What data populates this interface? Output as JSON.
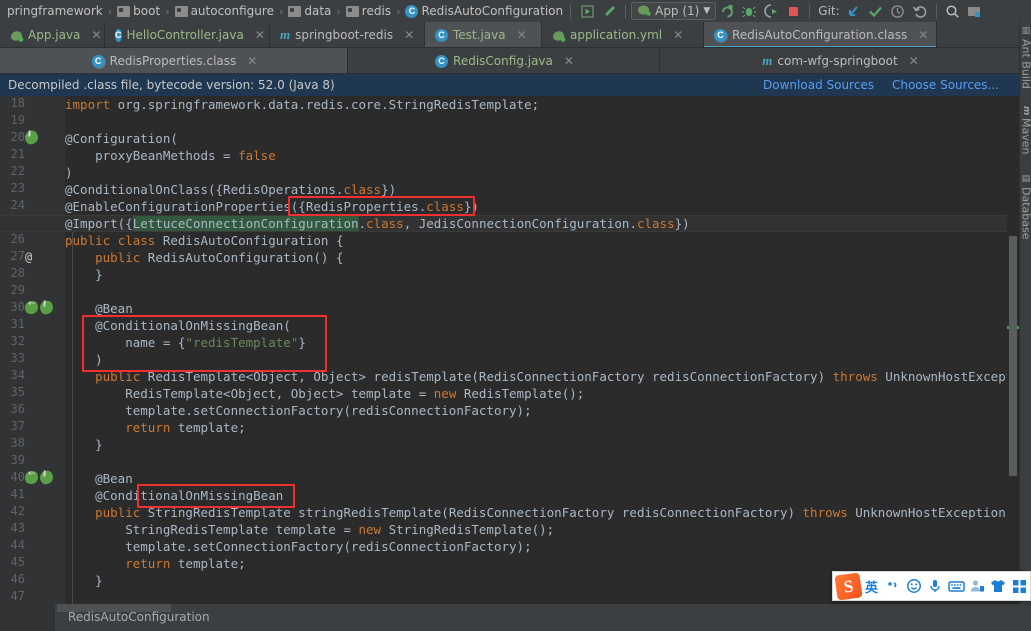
{
  "navbar": {
    "breadcrumbs": [
      {
        "label": "pringframework",
        "icon": "none"
      },
      {
        "label": "boot",
        "icon": "folder-icon"
      },
      {
        "label": "autoconfigure",
        "icon": "folder-icon"
      },
      {
        "label": "data",
        "icon": "folder-icon"
      },
      {
        "label": "redis",
        "icon": "folder-icon"
      },
      {
        "label": "RedisAutoConfiguration",
        "icon": "class-icon"
      }
    ],
    "run_config": "App (1)",
    "git_label": "Git:"
  },
  "tabs_row1": [
    {
      "label": "App.java",
      "icon": "spring-boot-icon",
      "color": "green",
      "active": false
    },
    {
      "label": "HelloController.java",
      "icon": "class-icon",
      "color": "green",
      "active": false
    },
    {
      "label": "springboot-redis",
      "icon": "maven-icon",
      "color": "grey",
      "active": false
    },
    {
      "label": "Test.java",
      "icon": "class-icon",
      "color": "green",
      "active": true
    },
    {
      "label": "application.yml",
      "icon": "spring-leaf-icon",
      "color": "green",
      "active": false
    },
    {
      "label": "RedisAutoConfiguration.class",
      "icon": "class-file-icon",
      "color": "grey",
      "active": true
    }
  ],
  "tabs_row2": [
    {
      "label": "RedisProperties.class",
      "icon": "class-file-icon",
      "color": "grey",
      "active": true
    },
    {
      "label": "RedisConfig.java",
      "icon": "class-icon",
      "color": "green",
      "active": false
    },
    {
      "label": "com-wfg-springboot",
      "icon": "maven-icon",
      "color": "grey",
      "active": false
    }
  ],
  "notification": {
    "message": "Decompiled .class file, bytecode version: 52.0 (Java 8)",
    "links": [
      "Download Sources",
      "Choose Sources..."
    ],
    "background": "#1f3750",
    "link_color": "#589df6"
  },
  "editor": {
    "first_line_number": 18,
    "highlighted_line_number": 25,
    "gutter_markers": [
      {
        "line": 20,
        "icons": [
          "bean-icon"
        ]
      },
      {
        "line": 27,
        "icons": [
          "at-icon"
        ]
      },
      {
        "line": 30,
        "icons": [
          "bean-override-icon",
          "bean-icon"
        ]
      },
      {
        "line": 40,
        "icons": [
          "bean-override-icon",
          "bean-icon"
        ]
      }
    ],
    "lines": [
      "import org.springframework.data.redis.core.StringRedisTemplate;",
      "",
      "@Configuration(",
      "    proxyBeanMethods = false",
      ")",
      "@ConditionalOnClass({RedisOperations.class})",
      "@EnableConfigurationProperties({RedisProperties.class})",
      "@Import({LettuceConnectionConfiguration.class, JedisConnectionConfiguration.class})",
      "public class RedisAutoConfiguration {",
      "    public RedisAutoConfiguration() {",
      "    }",
      "",
      "    @Bean",
      "    @ConditionalOnMissingBean(",
      "        name = {\"redisTemplate\"}",
      "    )",
      "    public RedisTemplate<Object, Object> redisTemplate(RedisConnectionFactory redisConnectionFactory) throws UnknownHostException {",
      "        RedisTemplate<Object, Object> template = new RedisTemplate();",
      "        template.setConnectionFactory(redisConnectionFactory);",
      "        return template;",
      "    }",
      "",
      "    @Bean",
      "    @ConditionalOnMissingBean",
      "    public StringRedisTemplate stringRedisTemplate(RedisConnectionFactory redisConnectionFactory) throws UnknownHostException {",
      "        StringRedisTemplate template = new StringRedisTemplate();",
      "        template.setConnectionFactory(redisConnectionFactory);",
      "        return template;",
      "    }",
      "",
      "}"
    ],
    "annotation_boxes": [
      {
        "name": "redis-properties-class-box",
        "label": "{RedisProperties.class})"
      },
      {
        "name": "conditional-on-missing-bean-box",
        "label": "@ConditionalOnMissingBean( name = {\"redisTemplate\"} )"
      },
      {
        "name": "string-redis-template-box",
        "label": "StringRedisTemplate"
      }
    ],
    "annotation_color": "#f03030",
    "background": "#2b2b2b",
    "gutter_background": "#313335"
  },
  "right_tool_strip": [
    {
      "label": "Ant Build",
      "icon": "ant-icon"
    },
    {
      "label": "Maven",
      "icon": "maven-icon"
    },
    {
      "label": "Database",
      "icon": "database-icon"
    }
  ],
  "statusbar": {
    "text": "RedisAutoConfiguration"
  },
  "ime": {
    "name": "sogou-input-method",
    "logo": "S",
    "mode": "英",
    "items": [
      {
        "icon": "punctuation-icon",
        "glyph": "ʔ,"
      },
      {
        "icon": "emoji-icon",
        "glyph": "☺"
      },
      {
        "icon": "microphone-icon",
        "glyph": "Ἲ4"
      },
      {
        "icon": "keyboard-icon",
        "glyph": "keyboard"
      },
      {
        "icon": "user-icon",
        "glyph": "὆4"
      },
      {
        "icon": "skin-icon",
        "glyph": "ὅ5"
      },
      {
        "icon": "apps-icon",
        "glyph": "grid"
      }
    ],
    "accent_color": "#1a7fd4",
    "logo_color": "#f4511e"
  }
}
